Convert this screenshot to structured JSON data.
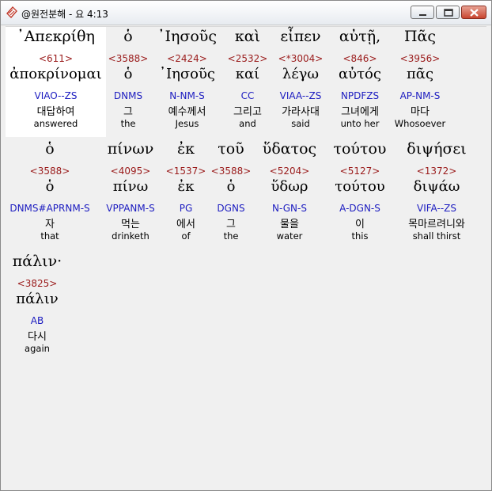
{
  "window": {
    "title": "@원전분해 - 요 4:13"
  },
  "words": [
    {
      "greek": "᾿Απεκρίθη",
      "strong": "<611>",
      "lemma": "ἀποκρίνομαι",
      "parse": "VIAO--ZS",
      "korean": "대답하여",
      "english": "answered"
    },
    {
      "greek": "ὁ",
      "strong": "<3588>",
      "lemma": "ὁ",
      "parse": "DNMS",
      "korean": "그",
      "english": "the"
    },
    {
      "greek": "᾿Ιησοῦς",
      "strong": "<2424>",
      "lemma": "᾿Ιησοῦς",
      "parse": "N-NM-S",
      "korean": "예수께서",
      "english": "Jesus"
    },
    {
      "greek": "καὶ",
      "strong": "<2532>",
      "lemma": "καί",
      "parse": "CC",
      "korean": "그리고",
      "english": "and"
    },
    {
      "greek": "εἶπεν",
      "strong": "<*3004>",
      "lemma": "λέγω",
      "parse": "VIAA--ZS",
      "korean": "가라사대",
      "english": "said"
    },
    {
      "greek": "αὐτῇ,",
      "strong": "<846>",
      "lemma": "αὐτός",
      "parse": "NPDFZS",
      "korean": "그녀에게",
      "english": "unto her"
    },
    {
      "greek": "Πᾶς",
      "strong": "<3956>",
      "lemma": "πᾶς",
      "parse": "AP-NM-S",
      "korean": "마다",
      "english": "Whosoever"
    },
    {
      "greek": "ὁ",
      "strong": "<3588>",
      "lemma": "ὁ",
      "parse": "DNMS#APRNM-S",
      "korean": "자",
      "english": "that"
    },
    {
      "greek": "πίνων",
      "strong": "<4095>",
      "lemma": "πίνω",
      "parse": "VPPANM-S",
      "korean": "먹는",
      "english": "drinketh"
    },
    {
      "greek": "ἐκ",
      "strong": "<1537>",
      "lemma": "ἐκ",
      "parse": "PG",
      "korean": "에서",
      "english": "of"
    },
    {
      "greek": "τοῦ",
      "strong": "<3588>",
      "lemma": "ὁ",
      "parse": "DGNS",
      "korean": "그",
      "english": "the"
    },
    {
      "greek": "ὕδατος",
      "strong": "<5204>",
      "lemma": "ὕδωρ",
      "parse": "N-GN-S",
      "korean": "물을",
      "english": "water"
    },
    {
      "greek": "τούτου",
      "strong": "<5127>",
      "lemma": "τούτου",
      "parse": "A-DGN-S",
      "korean": "이",
      "english": "this"
    },
    {
      "greek": "διψήσει",
      "strong": "<1372>",
      "lemma": "διψάω",
      "parse": "VIFA--ZS",
      "korean": "목마르려니와",
      "english": "shall thirst"
    },
    {
      "greek": "πάλιν·",
      "strong": "<3825>",
      "lemma": "πάλιν",
      "parse": "AB",
      "korean": "다시",
      "english": "again"
    }
  ]
}
